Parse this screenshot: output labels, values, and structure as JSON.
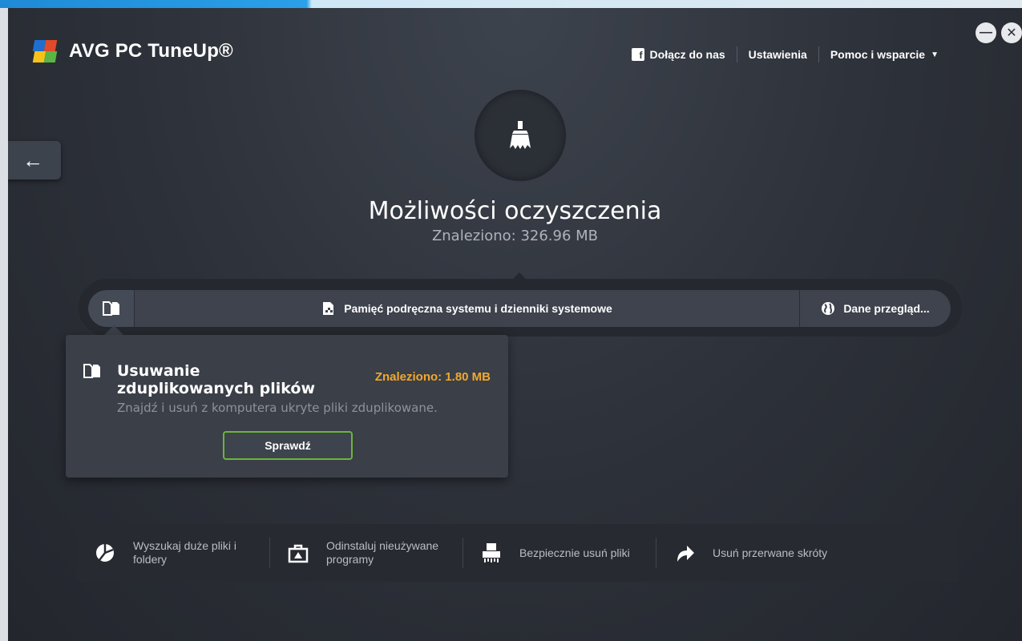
{
  "app": {
    "brand": "AVG",
    "product": "PC TuneUp®"
  },
  "window_controls": {
    "minimize": "—",
    "close": "✕"
  },
  "nav": {
    "facebook_label": "Dołącz do nas",
    "settings_label": "Ustawienia",
    "help_label": "Pomoc i wsparcie",
    "help_caret": "▼"
  },
  "back": {
    "label": "←"
  },
  "hero": {
    "icon": "broom-icon",
    "title": "Możliwości oczyszczenia",
    "subtitle": "Znaleziono: 326.96 MB"
  },
  "tabs": [
    {
      "icon": "duplicate-files-icon",
      "label": ""
    },
    {
      "icon": "system-cache-icon",
      "label": "Pamięć podręczna systemu i dzienniki systemowe"
    },
    {
      "icon": "globe-icon",
      "label": "Dane przegląd..."
    }
  ],
  "card": {
    "icon": "duplicate-files-icon",
    "title": "Usuwanie zduplikowanych plików",
    "found": "Znaleziono: 1.80 MB",
    "description": "Znajdź i usuń z komputera ukryte pliki zduplikowane.",
    "button": "Sprawdź"
  },
  "bottom_actions": [
    {
      "icon": "pie-chart-icon",
      "label": "Wyszukaj duże pliki i foldery"
    },
    {
      "icon": "uninstall-icon",
      "label": "Odinstaluj nieużywane programy"
    },
    {
      "icon": "shredder-icon",
      "label": "Bezpiecznie usuń pliki"
    },
    {
      "icon": "shortcut-arrow-icon",
      "label": "Usuń przerwane skróty"
    }
  ],
  "colors": {
    "accent_green": "#6cb53a",
    "found_orange": "#f2a92b",
    "bg": "#2c3038"
  }
}
